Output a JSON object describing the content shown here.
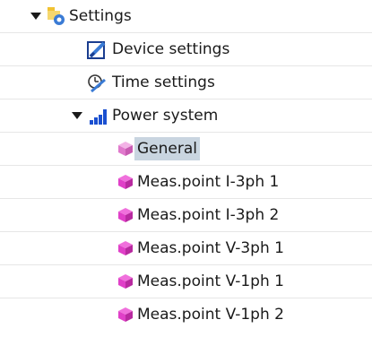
{
  "tree": {
    "settings": {
      "label": "Settings",
      "icon": "settings-folder-icon",
      "expanded": true
    },
    "device_settings": {
      "label": "Device settings",
      "icon": "device-settings-icon"
    },
    "time_settings": {
      "label": "Time settings",
      "icon": "time-settings-icon"
    },
    "power_system": {
      "label": "Power system",
      "icon": "power-system-icon",
      "expanded": true
    },
    "general": {
      "label": "General",
      "icon": "general-cube-icon",
      "selected": true
    },
    "meas_point_i3ph1": {
      "label": "Meas.point I-3ph 1",
      "icon": "measurement-cube-icon"
    },
    "meas_point_i3ph2": {
      "label": "Meas.point I-3ph 2",
      "icon": "measurement-cube-icon"
    },
    "meas_point_v3ph1": {
      "label": "Meas.point V-3ph 1",
      "icon": "measurement-cube-icon"
    },
    "meas_point_v1ph1": {
      "label": "Meas.point V-1ph 1",
      "icon": "measurement-cube-icon"
    },
    "meas_point_v1ph2": {
      "label": "Meas.point V-1ph 2",
      "icon": "measurement-cube-icon"
    }
  },
  "colors": {
    "selection": "#c9d5e0",
    "measurement_icon": "#e040c8",
    "general_icon": "#e079cc",
    "power_icon": "#1a4fd0"
  }
}
